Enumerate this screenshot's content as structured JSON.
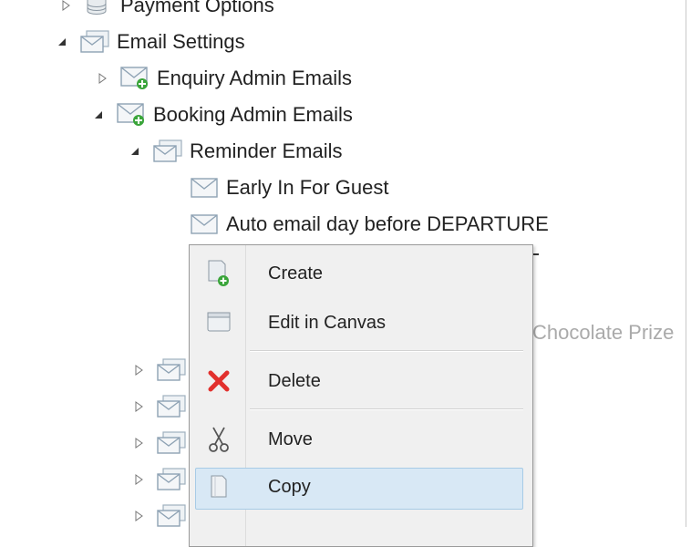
{
  "tree": {
    "items": [
      {
        "label": "Payment Options",
        "expanded": false,
        "icon": "database-icon"
      },
      {
        "label": "Email Settings",
        "expanded": true,
        "icon": "email-folder-icon"
      },
      {
        "label": "Enquiry Admin Emails",
        "expanded": false,
        "icon": "email-add-icon"
      },
      {
        "label": "Booking Admin Emails",
        "expanded": true,
        "icon": "email-add-icon"
      },
      {
        "label": "Reminder Emails",
        "expanded": true,
        "icon": "email-folder-icon"
      },
      {
        "label": "Early In For Guest",
        "icon": "envelope-icon"
      },
      {
        "label": "Auto email day before DEPARTURE",
        "icon": "envelope-icon"
      }
    ],
    "partial_text": "Chocolate Prize",
    "collapsed_folder_count": 5
  },
  "context_menu": {
    "items": [
      {
        "label": "Create",
        "icon": "create-page-icon"
      },
      {
        "label": "Edit in Canvas",
        "icon": "canvas-window-icon"
      },
      {
        "label": "Delete",
        "icon": "delete-x-icon"
      },
      {
        "label": "Move",
        "icon": "scissors-icon"
      },
      {
        "label": "Copy",
        "icon": "copy-page-icon",
        "highlighted": true
      }
    ]
  },
  "colors": {
    "highlight": "#d8e8f5",
    "highlight_border": "#a7cbe6",
    "delete_red": "#e2302d",
    "add_green": "#3aa53a"
  }
}
